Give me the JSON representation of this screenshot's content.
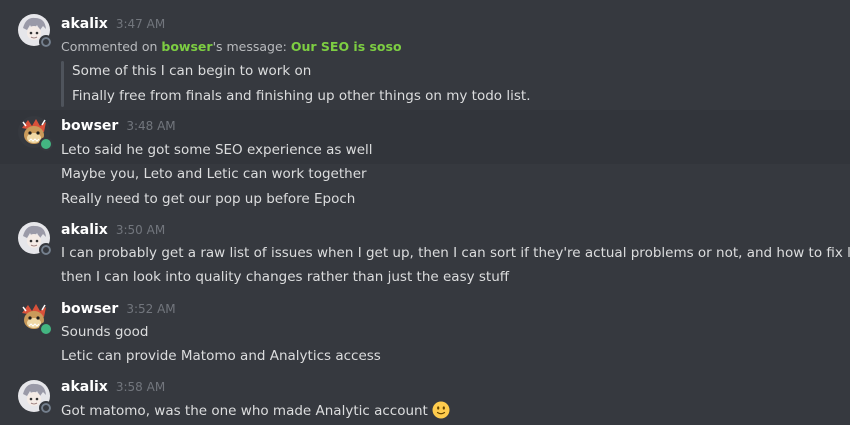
{
  "messages": [
    {
      "author": "akalix",
      "time": "3:47 AM",
      "status": "offline",
      "comment": {
        "prefix": "Commented on ",
        "target_user": "bowser",
        "middle": "'s message: ",
        "target_message": "Our SEO is soso"
      },
      "quote_lines": [
        "Some of this I can begin to work on",
        "Finally free from finals and finishing up other things on my todo list."
      ]
    },
    {
      "author": "bowser",
      "time": "3:48 AM",
      "status": "online",
      "lines": [
        "Leto said he got some SEO experience as well",
        "Maybe you, Leto and Letic can work together",
        "Really need to get our pop up before Epoch"
      ]
    },
    {
      "author": "akalix",
      "time": "3:50 AM",
      "status": "offline",
      "lines": [
        "I can probably get a raw list of issues when I get up, then I can sort if they're actual problems or not, and how to fix later",
        "then I can look into quality changes rather than just the easy stuff"
      ]
    },
    {
      "author": "bowser",
      "time": "3:52 AM",
      "status": "online",
      "lines": [
        "Sounds good",
        "Letic can provide Matomo and Analytics access"
      ]
    },
    {
      "author": "akalix",
      "time": "3:58 AM",
      "status": "offline",
      "lines": [
        "Got matomo, was the one who made Analytic account"
      ],
      "emoji": "slight-smile-emoji"
    }
  ],
  "colors": {
    "background": "#36393f",
    "highlight": "#32353b",
    "online": "#43b581",
    "mention": "#7dce42",
    "timestamp": "#72767d"
  }
}
